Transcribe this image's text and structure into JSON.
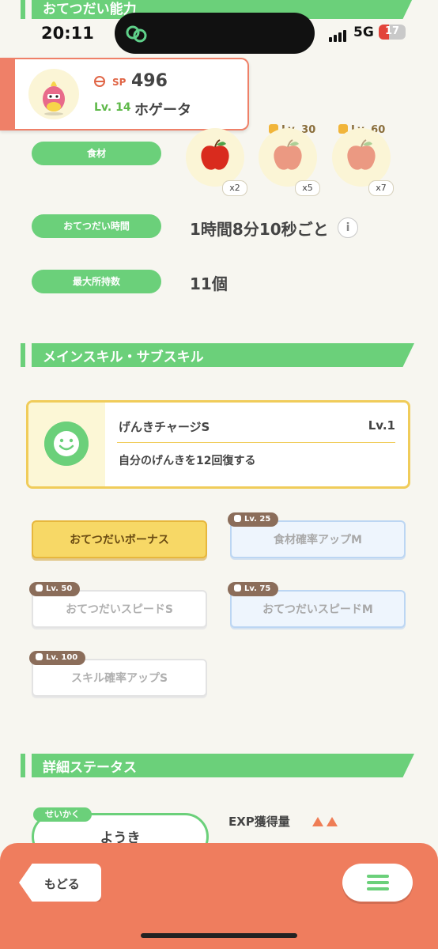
{
  "status_bar": {
    "time": "20:11",
    "network": "5G",
    "battery": "17"
  },
  "sections": {
    "ability": "おてつだい能力",
    "skills": "メインスキル・サブスキル",
    "details": "詳細ステータス"
  },
  "pokemon": {
    "sp_label": "SP",
    "sp": "496",
    "level": "Lv. 14",
    "name": "ホゲータ"
  },
  "stats": {
    "ingredients_label": "食材",
    "help_time_label": "おてつだい時間",
    "help_time_value": "1時間8分10秒ごと",
    "max_carry_label": "最大所持数",
    "max_carry_value": "11個"
  },
  "ingredients": [
    {
      "count": "x2",
      "locked": false,
      "lock_level": ""
    },
    {
      "count": "x5",
      "locked": true,
      "lock_level": "Lv. 30"
    },
    {
      "count": "x7",
      "locked": true,
      "lock_level": "Lv. 60"
    }
  ],
  "main_skill": {
    "name": "げんきチャージS",
    "level": "Lv.1",
    "description": "自分のげんきを12回復する"
  },
  "sub_skills": [
    {
      "label": "おてつだいボーナス",
      "lock": "",
      "style": "gold"
    },
    {
      "label": "食材確率アップM",
      "lock": "Lv. 25",
      "style": "blue"
    },
    {
      "label": "おてつだいスピードS",
      "lock": "Lv. 50",
      "style": "white"
    },
    {
      "label": "おてつだいスピードM",
      "lock": "Lv. 75",
      "style": "blue"
    },
    {
      "label": "スキル確率アップS",
      "lock": "Lv. 100",
      "style": "white"
    }
  ],
  "nature": {
    "tag": "せいかく",
    "value": "ようき"
  },
  "exp": {
    "label": "EXP獲得量",
    "arrows": 2
  },
  "nav": {
    "back": "もどる"
  },
  "colors": {
    "green": "#6bd07a",
    "orange": "#ef7d5e",
    "gold": "#f0cc5a"
  }
}
